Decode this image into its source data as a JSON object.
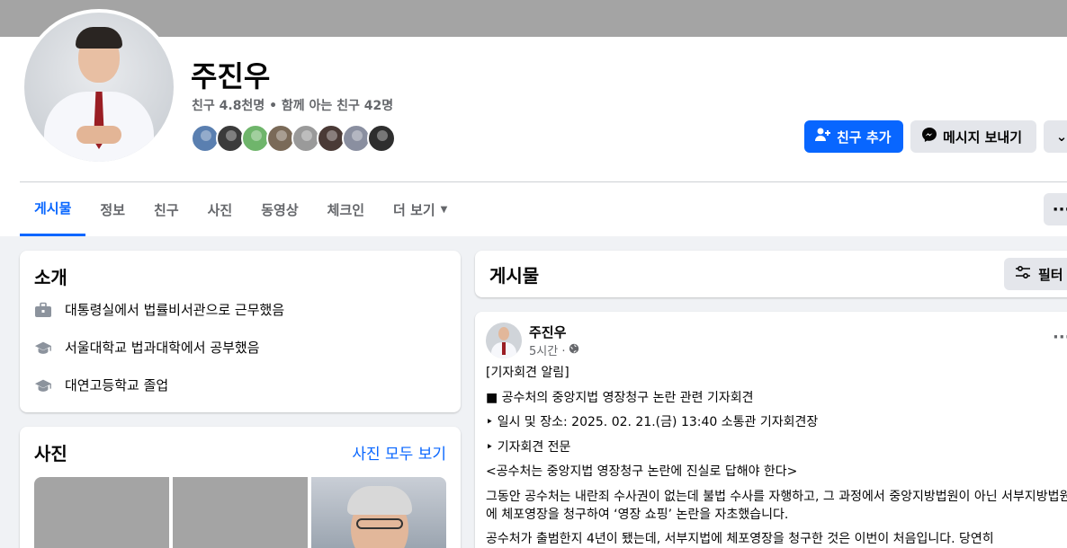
{
  "profile": {
    "name": "주진우",
    "friends_meta": "친구 4.8천명 • 함께 아는 친구 42명",
    "friend_avatar_colors": [
      "#5a7fb0",
      "#3b3b3b",
      "#6fb56b",
      "#7a6a58",
      "#9a9a9a",
      "#4a3a36",
      "#8a8fa0",
      "#2e2e2e"
    ]
  },
  "actions": {
    "add_friend": "친구 추가",
    "message": "메시지 보내기",
    "more": "⌄"
  },
  "tabs": [
    {
      "label": "게시물"
    },
    {
      "label": "정보"
    },
    {
      "label": "친구"
    },
    {
      "label": "사진"
    },
    {
      "label": "동영상"
    },
    {
      "label": "체크인"
    },
    {
      "label": "더 보기"
    }
  ],
  "tab_more_button": "···",
  "intro": {
    "title": "소개",
    "items": [
      {
        "icon": "briefcase-icon",
        "text": "대통령실에서 법률비서관으로 근무했음"
      },
      {
        "icon": "graduation-cap-icon",
        "text": "서울대학교 법과대학에서 공부했음"
      },
      {
        "icon": "graduation-cap-icon",
        "text": "대연고등학교 졸업"
      }
    ]
  },
  "photos": {
    "title": "사진",
    "see_all": "사진 모두 보기"
  },
  "posts_header": {
    "title": "게시물",
    "filter": "필터"
  },
  "post": {
    "author": "주진우",
    "time": "5시간 ·",
    "more": "···",
    "lines": [
      "[기자회견 알림]",
      "■ 공수처의 중앙지법 영장청구 논란 관련 기자회견",
      "‣  일시 및 장소: 2025. 02. 21.(금) 13:40 소통관 기자회견장",
      "‣  기자회견 전문",
      "<공수처는 중앙지법 영장청구 논란에 진실로 답해야 한다>",
      "그동안 공수처는 내란죄 수사권이 없는데 불법 수사를 자행하고, 그 과정에서 중앙지방법원이 아닌 서부지방법원에 체포영장을 청구하여 ‘영장 쇼핑’ 논란을 자초했습니다.",
      "공수처가 출범한지 4년이 됐는데, 서부지법에 체포영장을 청구한 것은 이번이 처음입니다. 당연히"
    ]
  }
}
